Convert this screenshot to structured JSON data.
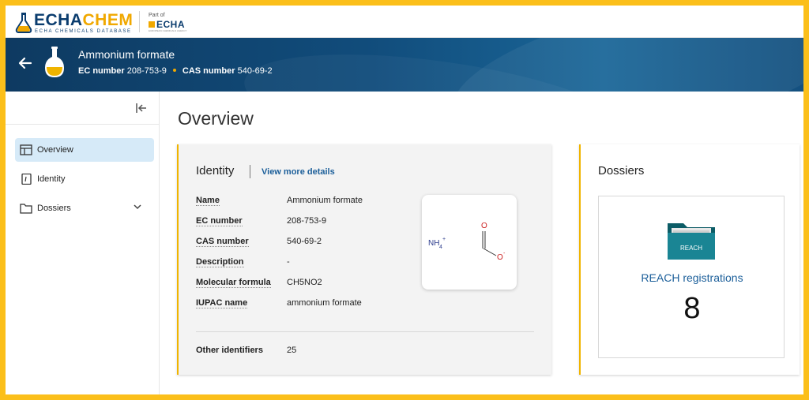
{
  "topbar": {
    "brand_left": "ECHA",
    "brand_right": "CHEM",
    "subtitle": "ECHA CHEMICALS DATABASE",
    "part_of": "Part of",
    "org": "ECHA",
    "org_tagline": "EUROPEAN CHEMICALS AGENCY"
  },
  "substance": {
    "name": "Ammonium formate",
    "ec_label": "EC number",
    "ec_value": "208-753-9",
    "cas_label": "CAS number",
    "cas_value": "540-69-2"
  },
  "sidebar": {
    "items": [
      {
        "label": "Overview",
        "icon": "overview-icon",
        "active": true
      },
      {
        "label": "Identity",
        "icon": "identity-icon",
        "active": false
      },
      {
        "label": "Dossiers",
        "icon": "folder-icon",
        "active": false
      }
    ]
  },
  "main": {
    "title": "Overview",
    "identity": {
      "heading": "Identity",
      "more_link": "View more details",
      "rows": [
        {
          "key": "Name",
          "value": "Ammonium formate"
        },
        {
          "key": "EC number",
          "value": "208-753-9"
        },
        {
          "key": "CAS number",
          "value": "540-69-2"
        },
        {
          "key": "Description",
          "value": "-"
        },
        {
          "key": "Molecular formula",
          "value": "CH5NO2"
        },
        {
          "key": "IUPAC name",
          "value": "ammonium formate"
        }
      ],
      "other_key": "Other identifiers",
      "other_value": "25",
      "structure": {
        "cation": "NH",
        "cation_sub": "4",
        "cation_sup": "+",
        "carbonyl_o": "O",
        "anion_o": "O",
        "anion_sup": "-"
      }
    },
    "dossiers": {
      "heading": "Dossiers",
      "folder_label": "REACH",
      "link": "REACH registrations",
      "count": "8"
    }
  },
  "colors": {
    "accent": "#f0b400",
    "link": "#1c5f9a",
    "header_dark": "#0e3a61",
    "active_nav": "#d6eaf8"
  }
}
